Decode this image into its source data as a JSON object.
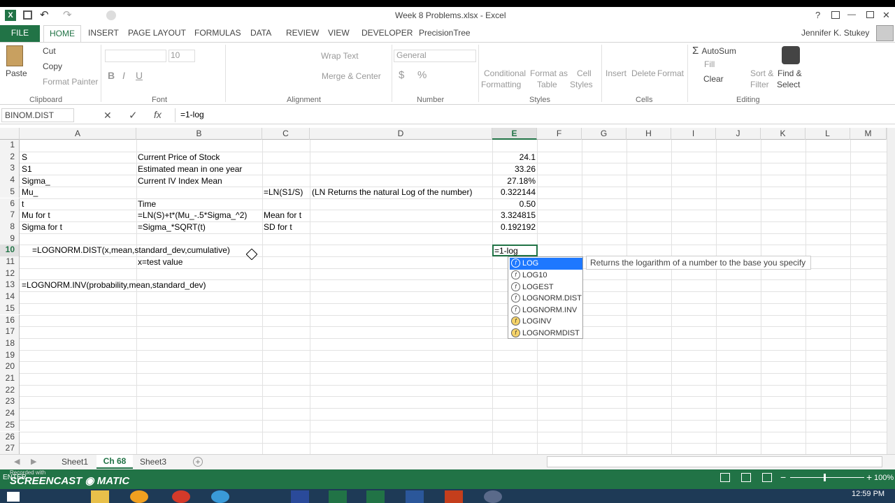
{
  "window": {
    "title": "Week 8 Problems.xlsx - Excel",
    "help": "?",
    "minimize": "—",
    "close": "✕"
  },
  "qat": {
    "new_title": "New",
    "undo": "↶",
    "redo": "↷"
  },
  "tabs": [
    "FILE",
    "HOME",
    "INSERT",
    "PAGE LAYOUT",
    "FORMULAS",
    "DATA",
    "REVIEW",
    "VIEW",
    "DEVELOPER",
    "PrecisionTree"
  ],
  "user": "Jennifer K. Stukey",
  "ribbon": {
    "clipboard": {
      "paste": "Paste",
      "cut": "Cut",
      "copy": "Copy",
      "painter": "Format Painter",
      "label": "Clipboard"
    },
    "font": {
      "size": "10",
      "label": "Font"
    },
    "alignment": {
      "wrap": "Wrap Text",
      "merge": "Merge & Center",
      "label": "Alignment"
    },
    "number": {
      "format": "General",
      "label": "Number"
    },
    "styles": {
      "cond1": "Conditional",
      "cond2": "Formatting",
      "fmt1": "Format as",
      "fmt2": "Table",
      "cell1": "Cell",
      "cell2": "Styles",
      "label": "Styles"
    },
    "cells": {
      "insert": "Insert",
      "delete": "Delete",
      "format": "Format",
      "label": "Cells"
    },
    "editing": {
      "autosum": "AutoSum",
      "fill": "Fill",
      "clear": "Clear",
      "sort1": "Sort &",
      "sort2": "Filter",
      "find1": "Find &",
      "find2": "Select",
      "label": "Editing"
    }
  },
  "formula_bar": {
    "name_box": "BINOM.DIST",
    "cancel": "✕",
    "enter": "✓",
    "fx": "fx",
    "formula": "=1-log"
  },
  "columns": [
    "A",
    "B",
    "C",
    "D",
    "E",
    "F",
    "G",
    "H",
    "I",
    "J",
    "K",
    "L",
    "M"
  ],
  "rows": [
    "1",
    "2",
    "3",
    "4",
    "5",
    "6",
    "7",
    "8",
    "9",
    "10",
    "11",
    "12",
    "13",
    "14",
    "15",
    "16",
    "17",
    "18",
    "19",
    "20",
    "21",
    "22",
    "23",
    "24",
    "25",
    "26",
    "27"
  ],
  "cells": {
    "A2": "S",
    "B2": "Current Price of Stock",
    "E2": "24.1",
    "A3": "S1",
    "B3": "Estimated mean in one year",
    "E3": "33.26",
    "A4": "Sigma_",
    "B4": "Current IV Index Mean",
    "E4": "27.18%",
    "A5": "Mu_",
    "C5": "=LN(S1/S)",
    "D5": "(LN Returns the natural Log of the number)",
    "E5": "0.322144",
    "A6": "t",
    "B6": "Time",
    "E6": "0.50",
    "A7": "Mu for t",
    "B7": "=LN(S)+t*(Mu_-.5*Sigma_^2)",
    "C7": "Mean for t",
    "E7": "3.324815",
    "A8": "Sigma for t",
    "B8": "=Sigma_*SQRT(t)",
    "C8": "SD for t",
    "E8": "0.192192",
    "A10": "=LOGNORM.DIST(x,mean,standard_dev,cumulative)",
    "E10": "=1-log",
    "B11": "x=test value",
    "A13": "=LOGNORM.INV(probability,mean,standard_dev)"
  },
  "autocomplete": [
    "LOG",
    "LOG10",
    "LOGEST",
    "LOGNORM.DIST",
    "LOGNORM.INV",
    "LOGINV",
    "LOGNORMDIST"
  ],
  "tooltip": "Returns the logarithm of a number to the base you specify",
  "sheets": [
    "Sheet1",
    "Ch 68",
    "Sheet3"
  ],
  "status": {
    "mode": "ENTER",
    "zoom": "100%",
    "watermark": "SCREENCAST",
    "watermark2": "MATIC",
    "recorded": "Recorded with"
  },
  "taskbar": {
    "time": "12:59 PM"
  }
}
